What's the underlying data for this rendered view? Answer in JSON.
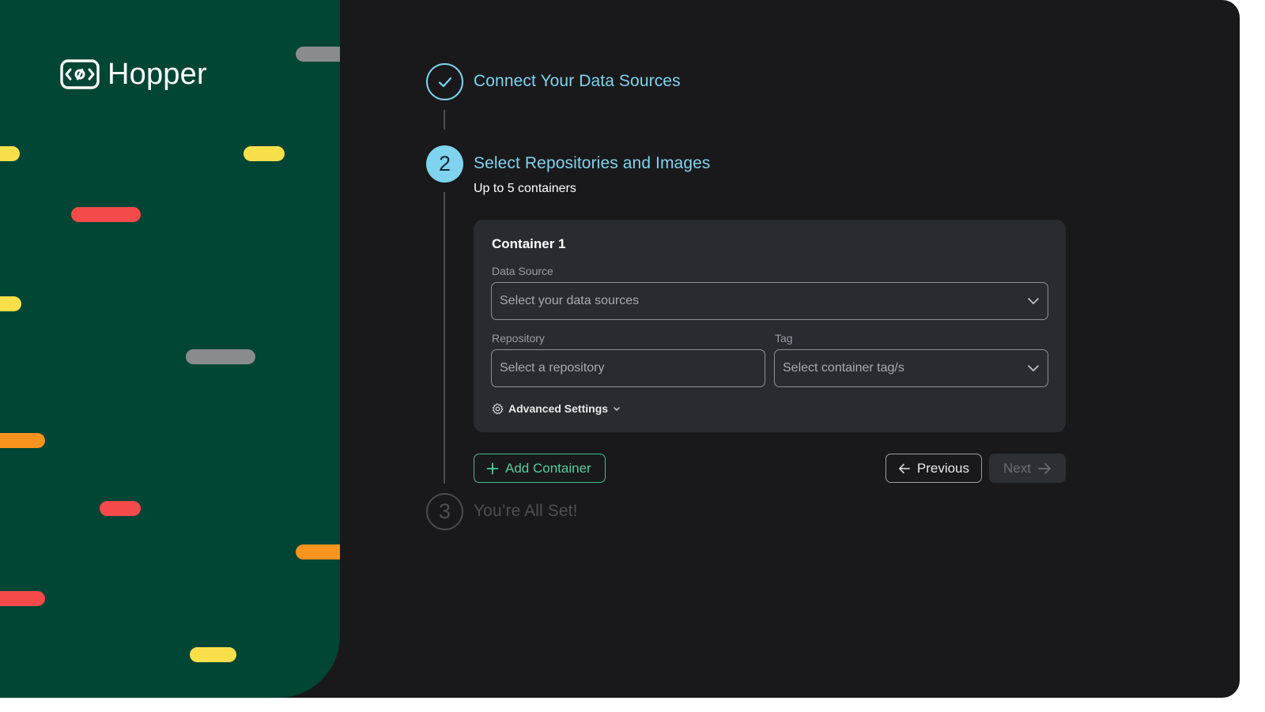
{
  "brand": {
    "name": "Hopper",
    "logo_icon": "eye-code-icon",
    "panel_color": "#014535",
    "pill_colors": {
      "yellow": "#f9e04b",
      "red": "#f44a4a",
      "orange": "#f9931f",
      "gray": "#8a8b8f"
    }
  },
  "stepper": {
    "accent_color": "#7fd3ee",
    "steps": [
      {
        "number": "",
        "title": "Connect Your Data Sources",
        "status": "completed",
        "icon": "check-icon"
      },
      {
        "number": "2",
        "title": "Select Repositories and Images",
        "subtitle": "Up to 5 containers",
        "status": "active"
      },
      {
        "number": "3",
        "title": "You’re All Set!",
        "status": "pending"
      }
    ]
  },
  "container_card": {
    "title": "Container 1",
    "data_source": {
      "label": "Data Source",
      "placeholder": "Select your data sources"
    },
    "repository": {
      "label": "Repository",
      "placeholder": "Select a repository"
    },
    "tag": {
      "label": "Tag",
      "placeholder": "Select container tag/s"
    },
    "advanced_settings": {
      "label": "Advanced Settings",
      "icon": "gear-icon"
    }
  },
  "actions": {
    "add_container": "Add Container",
    "previous": "Previous",
    "next": "Next",
    "add_color": "#3dbf8c"
  }
}
